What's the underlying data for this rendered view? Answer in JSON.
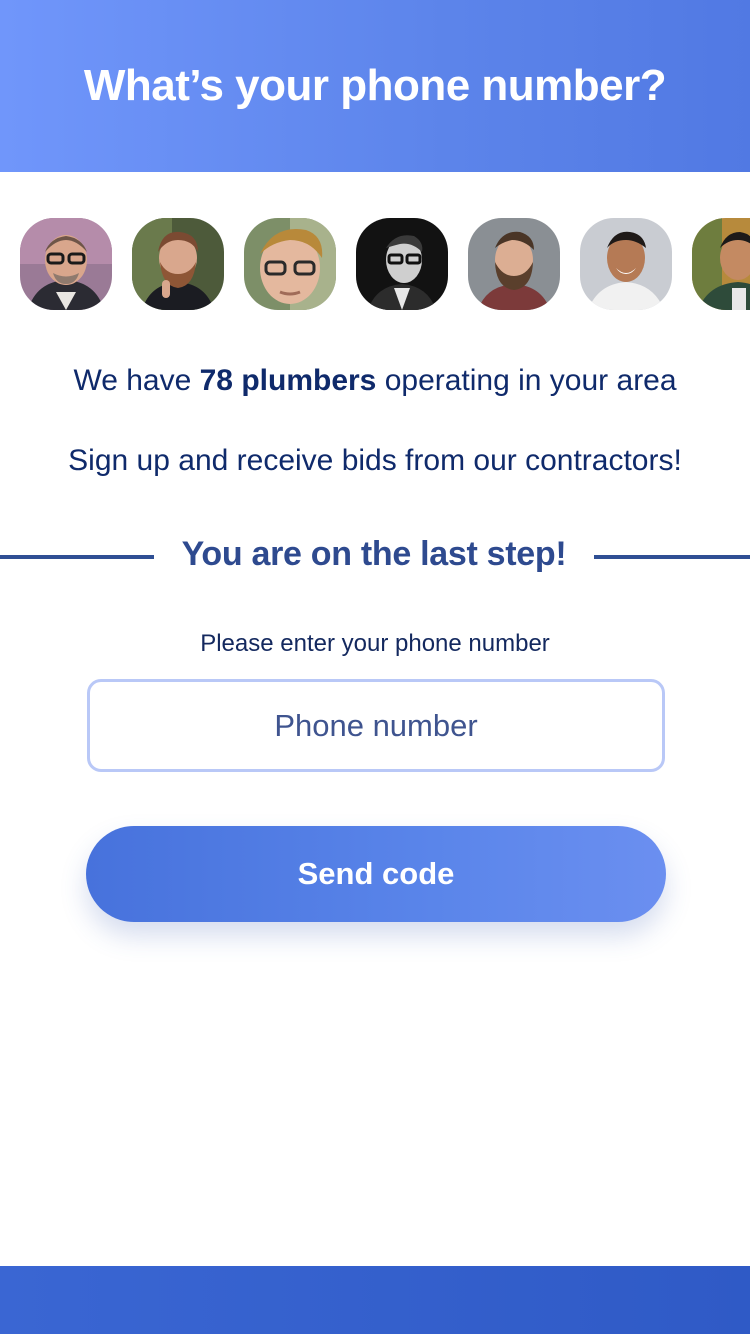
{
  "header": {
    "title": "What’s your phone number?"
  },
  "avatars": [
    {
      "name": "contractor-avatar-1"
    },
    {
      "name": "contractor-avatar-2"
    },
    {
      "name": "contractor-avatar-3"
    },
    {
      "name": "contractor-avatar-4"
    },
    {
      "name": "contractor-avatar-5"
    },
    {
      "name": "contractor-avatar-6"
    },
    {
      "name": "contractor-avatar-7"
    }
  ],
  "intro": {
    "prefix": "We have ",
    "highlight": "78 plumbers",
    "suffix": " operating in your area",
    "signup": "Sign up and receive bids from our contractors!"
  },
  "step": {
    "title": "You are on the last step!"
  },
  "form": {
    "prompt": "Please enter your phone number",
    "phone_placeholder": "Phone number",
    "phone_value": "",
    "submit_label": "Send code"
  },
  "colors": {
    "header_gradient_start": "#7096fb",
    "header_gradient_end": "#5179e3",
    "text_primary": "#0f2a6b",
    "accent": "#2f4f94",
    "button": "#4f7ae3",
    "input_border": "#b9c8f7",
    "footer": "#3360cc"
  }
}
